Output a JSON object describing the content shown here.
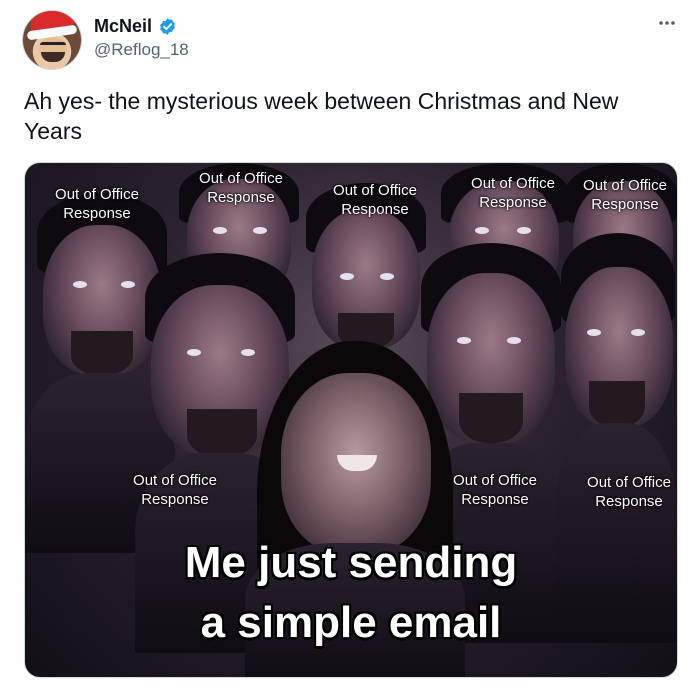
{
  "author": {
    "display_name": "McNeil",
    "handle": "@Reflog_18"
  },
  "tweet": {
    "text": "Ah yes- the mysterious week between Christmas and New Years"
  },
  "meme": {
    "labels": [
      "Out of Office Response",
      "Out of Office Response",
      "Out of Office Response",
      "Out of Office Response",
      "Out of Office Response",
      "Out of Office Response",
      "Out of Office Response",
      "Out of Office Response"
    ],
    "caption_line1": "Me just sending",
    "caption_line2": "a simple email"
  },
  "icons": {
    "verified": "verified-badge-icon",
    "more": "more-options-icon"
  },
  "colors": {
    "verified_blue": "#1d9bf0",
    "handle_gray": "#536471"
  }
}
